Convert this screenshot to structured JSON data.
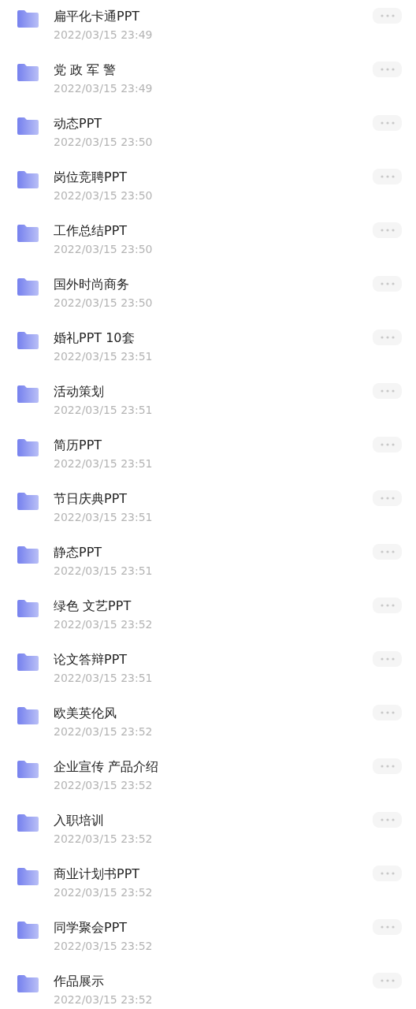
{
  "folders": [
    {
      "name": "扁平化卡通PPT",
      "date": "2022/03/15 23:49"
    },
    {
      "name": "党 政 军 警",
      "date": "2022/03/15 23:49"
    },
    {
      "name": "动态PPT",
      "date": "2022/03/15 23:50"
    },
    {
      "name": "岗位竞聘PPT",
      "date": "2022/03/15 23:50"
    },
    {
      "name": "工作总结PPT",
      "date": "2022/03/15 23:50"
    },
    {
      "name": "国外时尚商务",
      "date": "2022/03/15 23:50"
    },
    {
      "name": "婚礼PPT 10套",
      "date": "2022/03/15 23:51"
    },
    {
      "name": "活动策划",
      "date": "2022/03/15 23:51"
    },
    {
      "name": "简历PPT",
      "date": "2022/03/15 23:51"
    },
    {
      "name": "节日庆典PPT",
      "date": "2022/03/15 23:51"
    },
    {
      "name": "静态PPT",
      "date": "2022/03/15 23:51"
    },
    {
      "name": "绿色 文艺PPT",
      "date": "2022/03/15 23:52"
    },
    {
      "name": "论文答辩PPT",
      "date": "2022/03/15 23:51"
    },
    {
      "name": "欧美英伦风",
      "date": "2022/03/15 23:52"
    },
    {
      "name": "企业宣传 产品介绍",
      "date": "2022/03/15 23:52"
    },
    {
      "name": "入职培训",
      "date": "2022/03/15 23:52"
    },
    {
      "name": "商业计划书PPT",
      "date": "2022/03/15 23:52"
    },
    {
      "name": "同学聚会PPT",
      "date": "2022/03/15 23:52"
    },
    {
      "name": "作品展示",
      "date": "2022/03/15 23:52"
    }
  ]
}
